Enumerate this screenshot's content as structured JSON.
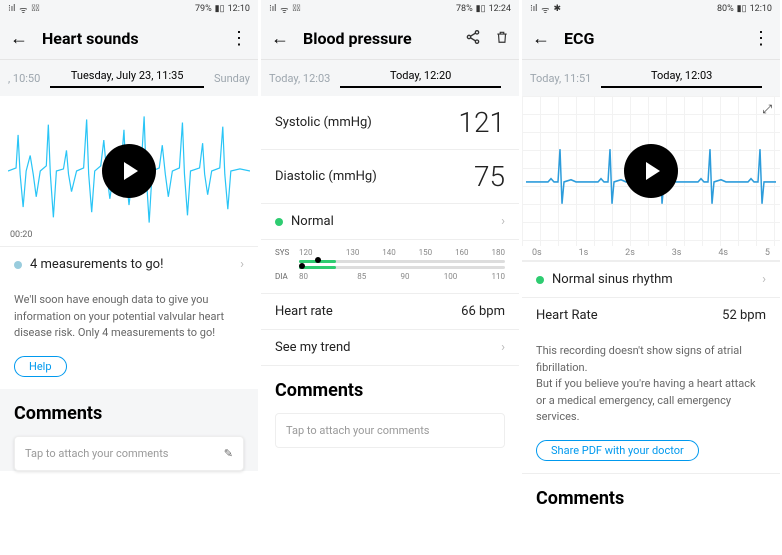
{
  "phone1": {
    "status": {
      "signal": "⁝ıl",
      "wifi": "ᯤ",
      "bt": "✱⃠",
      "battery": "79%",
      "batt_icon": "▮▯",
      "time": "12:10"
    },
    "title": "Heart sounds",
    "dates": {
      "prev": ", 10:50",
      "current": "Tuesday, July 23, 11:35",
      "next": "Sunday"
    },
    "wave_time": "00:20",
    "measure": {
      "text": "4 measurements to go!"
    },
    "body": "We'll soon have enough data to give you information on your potential valvular heart disease risk. Only 4 measurements to go!",
    "help": "Help",
    "comments_hdr": "Comments",
    "comments_ph": "Tap to attach your comments"
  },
  "phone2": {
    "status": {
      "signal": "⁝ıl",
      "wifi": "ᯤ",
      "bt": "✱⃠",
      "battery": "78%",
      "batt_icon": "▮▯",
      "time": "12:24"
    },
    "title": "Blood pressure",
    "dates": {
      "prev": "Today, 12:03",
      "current": "Today, 12:20",
      "next": ""
    },
    "systolic": {
      "label": "Systolic (mmHg)",
      "value": "121"
    },
    "diastolic": {
      "label": "Diastolic (mmHg)",
      "value": "75"
    },
    "status_row": "Normal",
    "scale": {
      "sys_label": "SYS",
      "sys_ticks": [
        "120",
        "130",
        "140",
        "150",
        "160",
        "180"
      ],
      "dia_label": "DIA",
      "dia_ticks": [
        "80",
        "85",
        "90",
        "100",
        "110"
      ]
    },
    "hr": {
      "label": "Heart rate",
      "value": "66 bpm"
    },
    "trend": "See my trend",
    "comments_hdr": "Comments",
    "comments_ph": "Tap to attach your comments"
  },
  "phone3": {
    "status": {
      "signal": "⁝ıl",
      "wifi": "ᯤ",
      "bt": "✱",
      "battery": "80%",
      "batt_icon": "▮▯",
      "time": "12:10"
    },
    "title": "ECG",
    "dates": {
      "prev": "Today, 11:51",
      "current": "Today, 12:03",
      "next": ""
    },
    "ecg_ticks": [
      "0s",
      "1s",
      "2s",
      "3s",
      "4s",
      "5"
    ],
    "status_row": "Normal sinus rhythm",
    "hr": {
      "label": "Heart Rate",
      "value": "52 bpm"
    },
    "body": "This recording doesn't show signs of atrial fibrillation.\nBut if you believe you're having a heart attack or a medical emergency, call emergency services.",
    "share": "Share PDF with your doctor",
    "comments_hdr": "Comments"
  },
  "chevron": "›"
}
